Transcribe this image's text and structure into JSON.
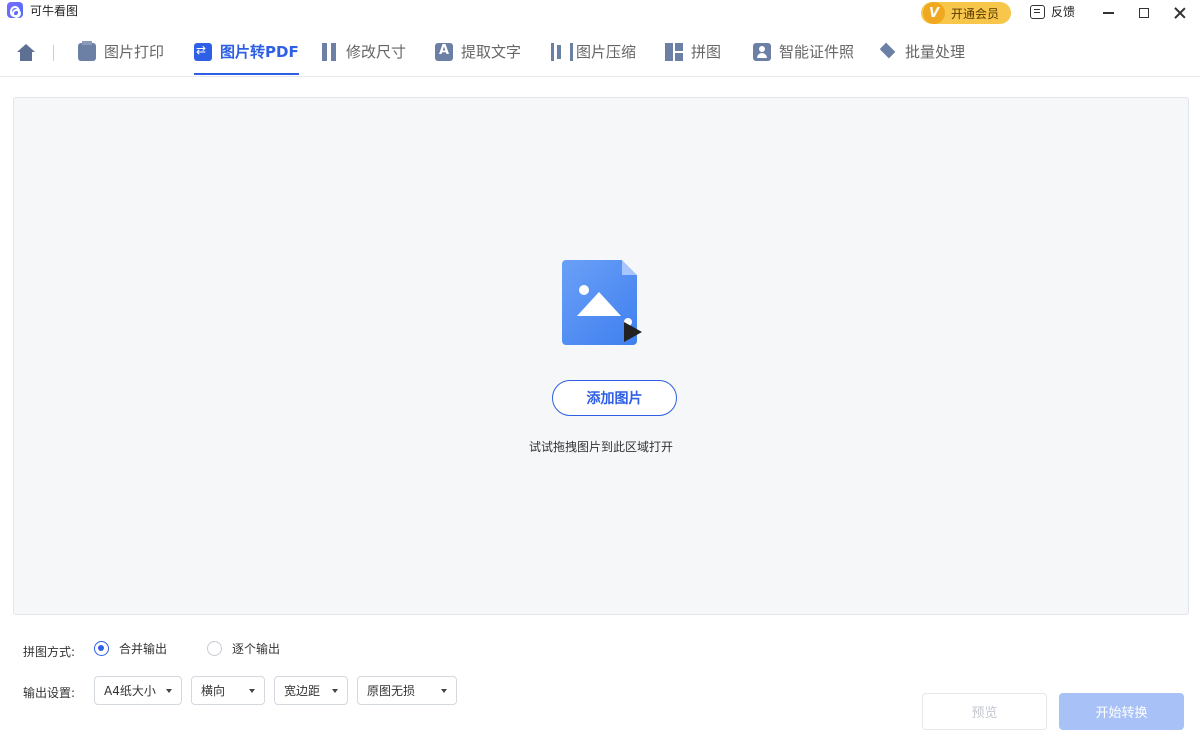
{
  "app": {
    "title": "可牛看图"
  },
  "titlebar": {
    "vip_badge": "V",
    "vip_label": "开通会员",
    "feedback_label": "反馈"
  },
  "nav": {
    "tabs": [
      {
        "label": "图片打印",
        "icon": "printer-icon"
      },
      {
        "label": "图片转PDF",
        "icon": "convert-icon",
        "active": true
      },
      {
        "label": "修改尺寸",
        "icon": "resize-icon"
      },
      {
        "label": "提取文字",
        "icon": "text-extract-icon"
      },
      {
        "label": "图片压缩",
        "icon": "compress-icon"
      },
      {
        "label": "拼图",
        "icon": "collage-icon"
      },
      {
        "label": "智能证件照",
        "icon": "id-photo-icon"
      },
      {
        "label": "批量处理",
        "icon": "batch-icon"
      }
    ]
  },
  "dropzone": {
    "add_button": "添加图片",
    "hint": "试试拖拽图片到此区域打开"
  },
  "settings": {
    "merge_mode_label": "拼图方式:",
    "merge_options": [
      {
        "label": "合并输出",
        "checked": true
      },
      {
        "label": "逐个输出",
        "checked": false
      }
    ],
    "output_label": "输出设置:",
    "selects": [
      "A4纸大小",
      "横向",
      "宽边距",
      "原图无损"
    ]
  },
  "actions": {
    "preview": "预览",
    "start": "开始转换"
  },
  "colors": {
    "accent": "#2f5fe4",
    "vip": "#f7c64a",
    "start_disabled": "#a8c1f7"
  }
}
